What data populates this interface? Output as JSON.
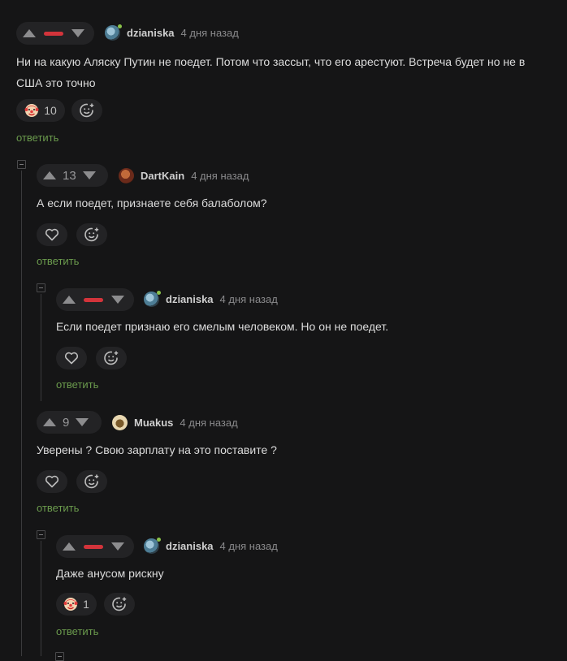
{
  "comments": [
    {
      "author": "dzianiska",
      "time": "4 дня назад",
      "text_line1": "Ни на какую Аляску Путин не поедет. Потом что зассыт, что его арестуют. Встреча будет но не в",
      "text_line2": "США это точно",
      "rating_display": "minus",
      "reaction": "clown-face",
      "reaction_count": "10",
      "reply_label": "ответить"
    },
    {
      "author": "DartKain",
      "time": "4 дня назад",
      "text_line1": "А если поедет, признаете себя балаболом?",
      "rating": "13",
      "reaction": "heart",
      "reply_label": "ответить"
    },
    {
      "author": "dzianiska",
      "time": "4 дня назад",
      "text_line1": "Если поедет признаю его смелым человеком. Но он не поедет.",
      "rating_display": "minus",
      "reaction": "heart",
      "reply_label": "ответить"
    },
    {
      "author": "Muakus",
      "time": "4 дня назад",
      "text_line1": "Уверены ? Свою зарплату на это поставите ?",
      "rating": "9",
      "reaction": "heart",
      "reply_label": "ответить"
    },
    {
      "author": "dzianiska",
      "time": "4 дня назад",
      "text_line1": "Даже анусом рискну",
      "rating_display": "minus",
      "reaction": "clown-face",
      "reaction_count": "1",
      "reply_label": "ответить"
    }
  ],
  "icons": {
    "upvote": "triangle-up-icon",
    "downvote": "triangle-down-icon",
    "add_reaction": "smile-plus-icon",
    "collapse": "collapse-minus-icon"
  },
  "colors": {
    "background": "#151516",
    "minus_rating": "#d3343b",
    "reply_link": "#6b9b4d",
    "online": "#8bc34a"
  }
}
